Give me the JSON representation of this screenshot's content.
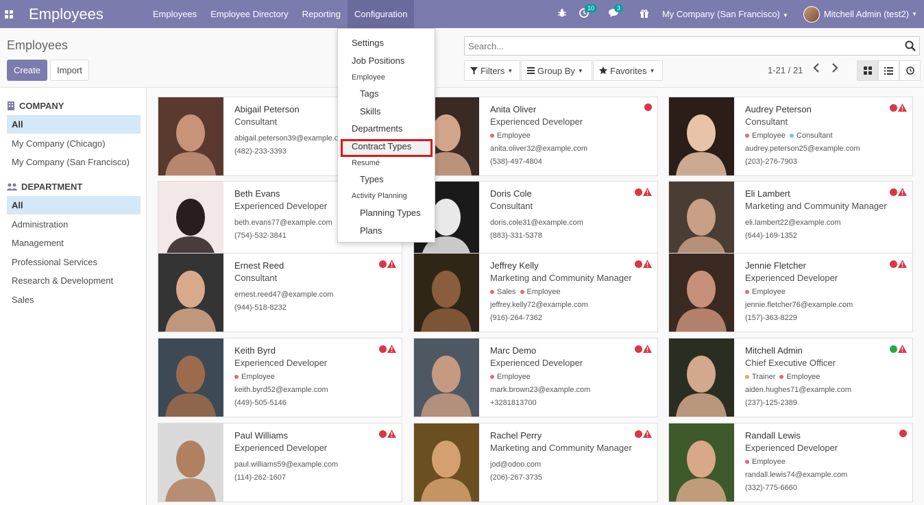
{
  "navbar": {
    "app_title": "Employees",
    "menu": [
      "Employees",
      "Employee Directory",
      "Reporting",
      "Configuration"
    ],
    "activity_badge": "10",
    "messages_badge": "3",
    "company": "My Company (San Francisco)",
    "user": "Mitchell Admin (test2)",
    "color": "#7c7bad"
  },
  "control_panel": {
    "title": "Employees",
    "create_label": "Create",
    "import_label": "Import",
    "search_placeholder": "Search...",
    "filters_label": "Filters",
    "groupby_label": "Group By",
    "favorites_label": "Favorites",
    "pager": "1-21 / 21"
  },
  "sidebar": {
    "company_header": "COMPANY",
    "companies": [
      "All",
      "My Company (Chicago)",
      "My Company (San Francisco)"
    ],
    "department_header": "DEPARTMENT",
    "departments": [
      "All",
      "Administration",
      "Management",
      "Professional Services",
      "Research & Development",
      "Sales"
    ]
  },
  "config_menu": {
    "settings": "Settings",
    "job_positions": "Job Positions",
    "employee_header": "Employee",
    "tags": "Tags",
    "skills": "Skills",
    "departments": "Departments",
    "contract_types": "Contract Types",
    "resume_header": "Resumé",
    "types": "Types",
    "activity_planning_header": "Activity Planning",
    "planning_types": "Planning Types",
    "plans": "Plans"
  },
  "employees": [
    {
      "name": "Abigail Peterson",
      "job": "Consultant",
      "tags": [],
      "email": "abigail.peterson39@example.com",
      "phone": "(482)-233-3393",
      "status": "red",
      "warning": false
    },
    {
      "name": "Anita Oliver",
      "job": "Experienced Developer",
      "tags": [
        "Employee"
      ],
      "email": "anita.oliver32@example.com",
      "phone": "(538)-497-4804",
      "status": "red",
      "warning": false
    },
    {
      "name": "Audrey Peterson",
      "job": "Consultant",
      "tags": [
        "Employee",
        "Consultant"
      ],
      "email": "audrey.peterson25@example.com",
      "phone": "(203)-276-7903",
      "status": "red",
      "warning": true
    },
    {
      "name": "Beth Evans",
      "job": "Experienced Developer",
      "tags": [],
      "email": "beth.evans77@example.com",
      "phone": "(754)-532-3841",
      "status": "red",
      "warning": true
    },
    {
      "name": "Doris Cole",
      "job": "Consultant",
      "tags": [],
      "email": "doris.cole31@example.com",
      "phone": "(883)-331-5378",
      "status": "red",
      "warning": true
    },
    {
      "name": "Eli Lambert",
      "job": "Marketing and Community Manager",
      "tags": [],
      "email": "eli.lambert22@example.com",
      "phone": "(644)-169-1352",
      "status": "red",
      "warning": true
    },
    {
      "name": "Ernest Reed",
      "job": "Consultant",
      "tags": [],
      "email": "ernest.reed47@example.com",
      "phone": "(944)-518-8232",
      "status": "red",
      "warning": true
    },
    {
      "name": "Jeffrey Kelly",
      "job": "Marketing and Community Manager",
      "tags": [
        "Sales",
        "Employee"
      ],
      "email": "jeffrey.kelly72@example.com",
      "phone": "(916)-264-7362",
      "status": "red",
      "warning": true
    },
    {
      "name": "Jennie Fletcher",
      "job": "Experienced Developer",
      "tags": [
        "Employee"
      ],
      "email": "jennie.fletcher76@example.com",
      "phone": "(157)-363-8229",
      "status": "red",
      "warning": true
    },
    {
      "name": "Keith Byrd",
      "job": "Experienced Developer",
      "tags": [
        "Employee"
      ],
      "email": "keith.byrd52@example.com",
      "phone": "(449)-505-5146",
      "status": "red",
      "warning": true
    },
    {
      "name": "Marc Demo",
      "job": "Experienced Developer",
      "tags": [
        "Employee"
      ],
      "email": "mark.brown23@example.com",
      "phone": "+3281813700",
      "status": "red",
      "warning": true
    },
    {
      "name": "Mitchell Admin",
      "job": "Chief Executive Officer",
      "tags": [
        "Trainer",
        "Employee"
      ],
      "email": "aiden.hughes71@example.com",
      "phone": "(237)-125-2389",
      "status": "green",
      "warning": true
    },
    {
      "name": "Paul Williams",
      "job": "Experienced Developer",
      "tags": [],
      "email": "paul.williams59@example.com",
      "phone": "(114)-262-1607",
      "status": "red",
      "warning": true
    },
    {
      "name": "Rachel Perry",
      "job": "Marketing and Community Manager",
      "tags": [],
      "email": "jod@odoo.com",
      "phone": "(206)-267-3735",
      "status": "red",
      "warning": true
    },
    {
      "name": "Randall Lewis",
      "job": "Experienced Developer",
      "tags": [
        "Employee"
      ],
      "email": "randall.lewis74@example.com",
      "phone": "(332)-775-6660",
      "status": "red",
      "warning": false
    }
  ],
  "tag_colors": {
    "Employee": "#e46a76",
    "Consultant": "#6cc1ed",
    "Sales": "#e46a76",
    "Trainer": "#f4a460"
  },
  "status_colors": {
    "red": "#dc3545",
    "green": "#28a745"
  }
}
